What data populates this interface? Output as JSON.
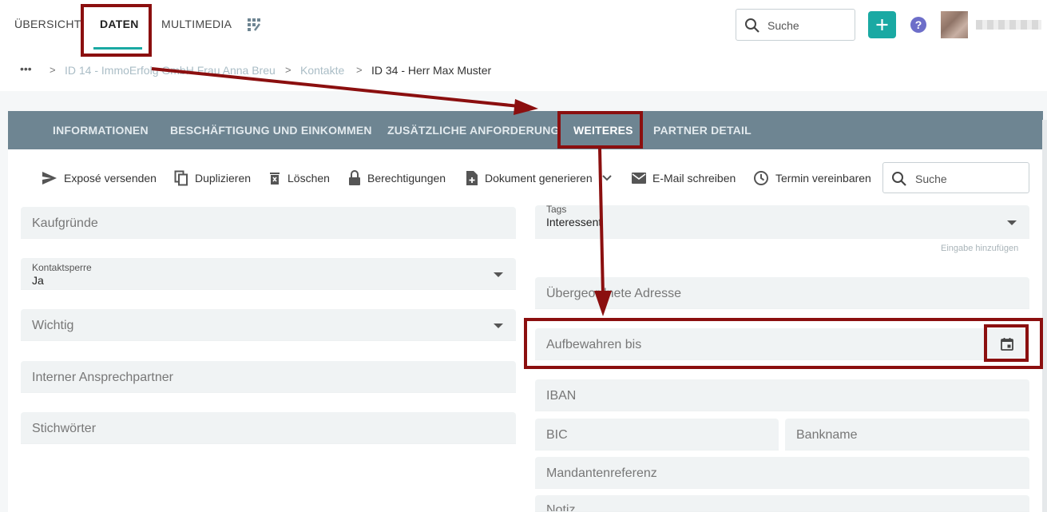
{
  "topnav": {
    "tabs": [
      {
        "label": "ÜBERSICHT"
      },
      {
        "label": "DATEN"
      },
      {
        "label": "MULTIMEDIA"
      }
    ],
    "search_placeholder": "Suche",
    "add_label": "+",
    "help_label": "?"
  },
  "breadcrumb": {
    "more": "•••",
    "separator": ">",
    "items": [
      {
        "label": "ID 14 - ImmoErfolg GmbH Frau Anna Breu"
      },
      {
        "label": "Kontakte"
      },
      {
        "label": "ID 34 - Herr Max Muster"
      }
    ]
  },
  "subtabs": [
    {
      "label": "INFORMATIONEN"
    },
    {
      "label": "BESCHÄFTIGUNG UND EINKOMMEN"
    },
    {
      "label": "ZUSÄTZLICHE ANFORDERUNG"
    },
    {
      "label": "WEITERES"
    },
    {
      "label": "PARTNER DETAIL"
    }
  ],
  "actions": [
    {
      "label": "Exposé versenden",
      "icon": "send-icon"
    },
    {
      "label": "Duplizieren",
      "icon": "copy-icon"
    },
    {
      "label": "Löschen",
      "icon": "trash-icon"
    },
    {
      "label": "Berechtigungen",
      "icon": "lock-icon"
    },
    {
      "label": "Dokument generieren",
      "icon": "document-add-icon"
    },
    {
      "label": "E-Mail schreiben",
      "icon": "mail-icon"
    },
    {
      "label": "Termin vereinbaren",
      "icon": "clock-icon"
    }
  ],
  "content_search_placeholder": "Suche",
  "left_fields": {
    "kaufgruende": "Kaufgründe",
    "kontaktsperre_label": "Kontaktsperre",
    "kontaktsperre_value": "Ja",
    "wichtig": "Wichtig",
    "ansprechpartner": "Interner Ansprechpartner",
    "stichwoerter": "Stichwörter"
  },
  "right_fields": {
    "tags_label": "Tags",
    "tags_value": "Interessent",
    "tags_hint": "Eingabe hinzufügen",
    "adresse": "Übergeordnete Adresse",
    "aufbewahren": "Aufbewahren bis",
    "iban": "IBAN",
    "bic": "BIC",
    "bankname": "Bankname",
    "mandantenreferenz": "Mandantenreferenz",
    "notiz": "Notiz"
  },
  "colors": {
    "accent": "#1aa9a3",
    "subnav_bg": "#6e8592",
    "highlight": "#8b0f0f",
    "help": "#6d6ec9"
  }
}
